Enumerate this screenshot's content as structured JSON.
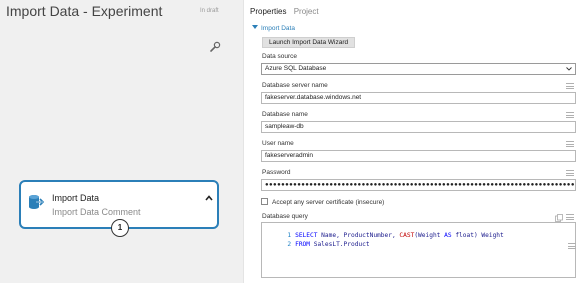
{
  "experiment": {
    "title": "Import Data - Experiment",
    "status": "In draft"
  },
  "module": {
    "name": "Import Data",
    "comment": "Import Data Comment",
    "output_port": "1"
  },
  "panel": {
    "tabs": [
      "Properties",
      "Project"
    ],
    "section_title": "Import Data",
    "launch_button": "Launch Import Data Wizard",
    "data_source_label": "Data source",
    "data_source_value": "Azure SQL Database",
    "server_label": "Database server name",
    "server_value": "fakeserver.database.windows.net",
    "db_label": "Database name",
    "db_value": "sampleaw-db",
    "user_label": "User name",
    "user_value": "fakeserveradmin",
    "password_label": "Password",
    "password_value": "●●●●●●●●●●●●●●●●●●●●●●●●●●●●●●●●●●●●●●●●●●●●●●●●●●●●●●●●●●●●●●●●●●●●●●●●●●●●●●●●●●●●●●●●●●●●●",
    "cert_label": "Accept any server certificate (insecure)",
    "cert_checked": false,
    "query_label": "Database query",
    "query_lines": [
      {
        "n": "1",
        "k1": "SELECT",
        "t1": " Name, ProductNumber, ",
        "f": "CAST",
        "t2": "(Weight ",
        "k2": "AS",
        "t3": " float) Weight"
      },
      {
        "n": "2",
        "k1": "FROM",
        "t1": " SalesLT.Product"
      }
    ]
  },
  "colors": {
    "accent": "#2b7fb8",
    "canvas_bg": "#f0f0f0",
    "keyword": "#0000ff",
    "function": "#c00000"
  },
  "icons": [
    "wrench-icon",
    "import-data-icon",
    "chevron-up-icon",
    "chevron-down-icon",
    "copy-icon",
    "drag-handle-icon"
  ]
}
